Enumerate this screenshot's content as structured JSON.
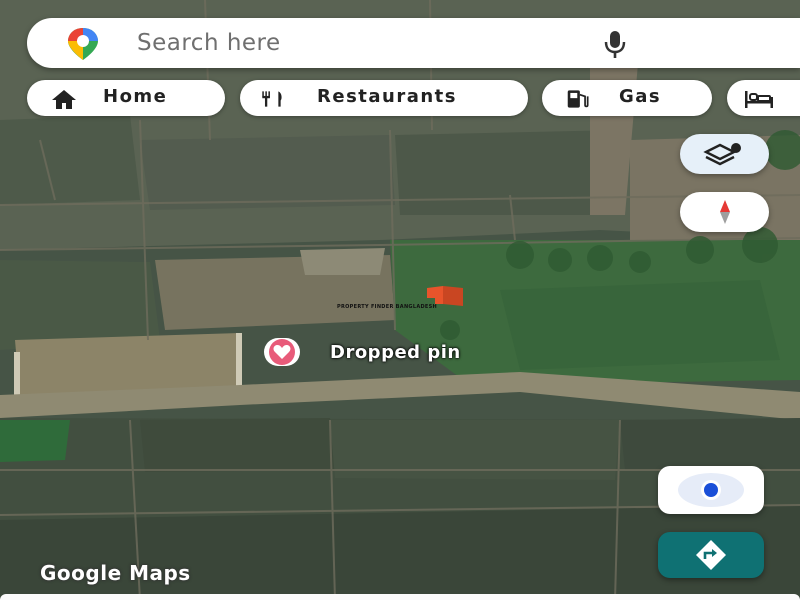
{
  "search": {
    "placeholder_text": "Search here"
  },
  "chips": [
    {
      "label": "Home",
      "icon": "home-icon"
    },
    {
      "label": "Restaurants",
      "icon": "restaurant-icon"
    },
    {
      "label": "Gas",
      "icon": "gas-station-icon"
    },
    {
      "label": "",
      "icon": "hotel-icon"
    }
  ],
  "map": {
    "pin_label": "Dropped pin",
    "overlay_logo_text": "PROPERTY FINDER BANGLADESH",
    "attribution": "Google Maps"
  },
  "controls": [
    "layers-icon",
    "compass-icon",
    "my-location-icon",
    "directions-icon"
  ],
  "colors": {
    "pin": "#e85b7a",
    "directions_button": "#0f7173",
    "location_dot": "#1a4fd8",
    "compass_needle": "#e53935"
  }
}
